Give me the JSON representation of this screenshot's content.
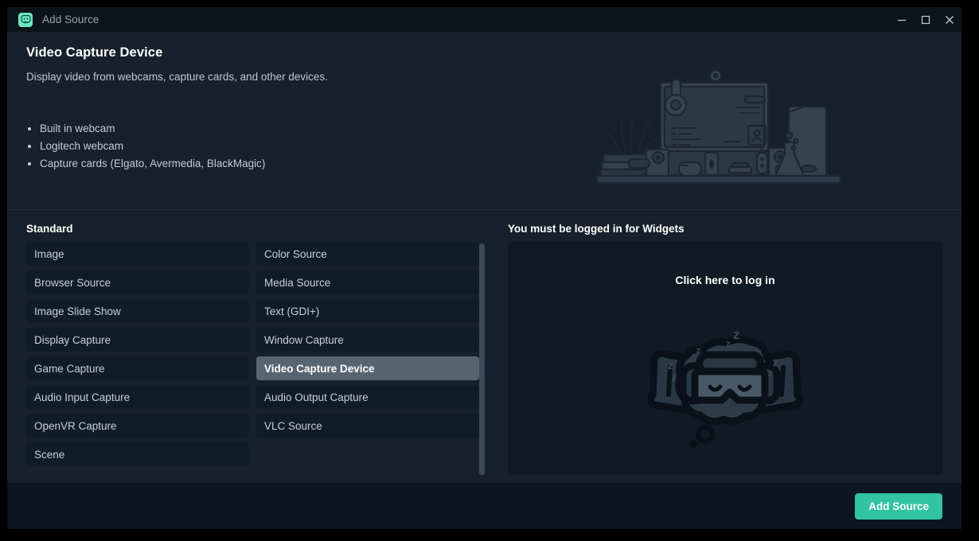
{
  "window": {
    "title": "Add Source",
    "app_icon": "streamlabs-chat-icon",
    "controls": {
      "minimize": "minimize-icon",
      "maximize": "maximize-icon",
      "close": "close-icon"
    }
  },
  "hero": {
    "title": "Video Capture Device",
    "subtitle": "Display video from webcams, capture cards, and other devices.",
    "bullets": [
      "Built in webcam",
      "Logitech webcam",
      "Capture cards (Elgato, Avermedia, BlackMagic)"
    ],
    "illustration": "desk-setup-illustration"
  },
  "standard": {
    "heading": "Standard",
    "selected": "Video Capture Device",
    "column_left": [
      "Image",
      "Browser Source",
      "Image Slide Show",
      "Display Capture",
      "Game Capture",
      "Audio Input Capture",
      "OpenVR Capture",
      "Scene"
    ],
    "column_right": [
      "Color Source",
      "Media Source",
      "Text (GDI+)",
      "Window Capture",
      "Video Capture Device",
      "Audio Output Capture",
      "VLC Source",
      ""
    ]
  },
  "widgets": {
    "heading": "You must be logged in for Widgets",
    "login_label": "Click here to log in",
    "illustration": "sleeping-character-illustration"
  },
  "footer": {
    "add_source_label": "Add Source"
  },
  "colors": {
    "accent": "#31C3A2",
    "window_bg": "#16212C",
    "titlebar_bg": "#0C1319",
    "panel_bg": "#0F1A24",
    "item_bg": "#101C26",
    "item_selected_bg": "#576570",
    "footer_bg": "#0C1620",
    "app_icon_bg": "#6BE8C0"
  }
}
